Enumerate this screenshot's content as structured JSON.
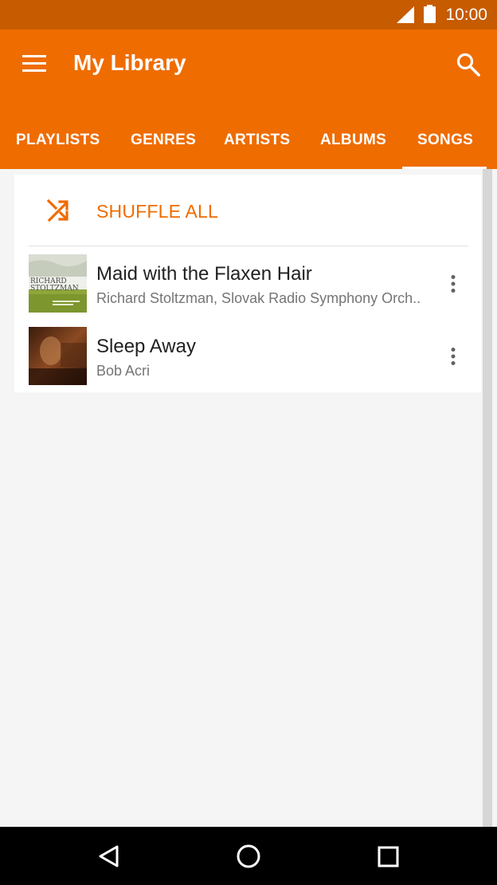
{
  "status_bar": {
    "time": "10:00"
  },
  "app_bar": {
    "title": "My Library"
  },
  "tabs": [
    {
      "label": "PLAYLISTS"
    },
    {
      "label": "GENRES"
    },
    {
      "label": "ARTISTS"
    },
    {
      "label": "ALBUMS"
    },
    {
      "label": "SONGS"
    }
  ],
  "active_tab": "SONGS",
  "shuffle": {
    "label": "SHUFFLE ALL"
  },
  "songs": [
    {
      "title": "Maid with the Flaxen Hair",
      "artist": "Richard Stoltzman, Slovak Radio Symphony Orch.."
    },
    {
      "title": "Sleep Away",
      "artist": "Bob Acri"
    }
  ],
  "album_art_text": {
    "line1": "RICHARD",
    "line2": "STOLTZMAN"
  },
  "colors": {
    "accent": "#ef6c00",
    "status_bar": "#c75b00",
    "background": "#f5f5f5"
  },
  "icons": {
    "menu": "menu-icon",
    "search": "search-icon",
    "shuffle": "shuffle-icon",
    "more": "more-vert-icon",
    "back": "back-icon",
    "home": "home-icon",
    "recent": "recent-apps-icon"
  }
}
